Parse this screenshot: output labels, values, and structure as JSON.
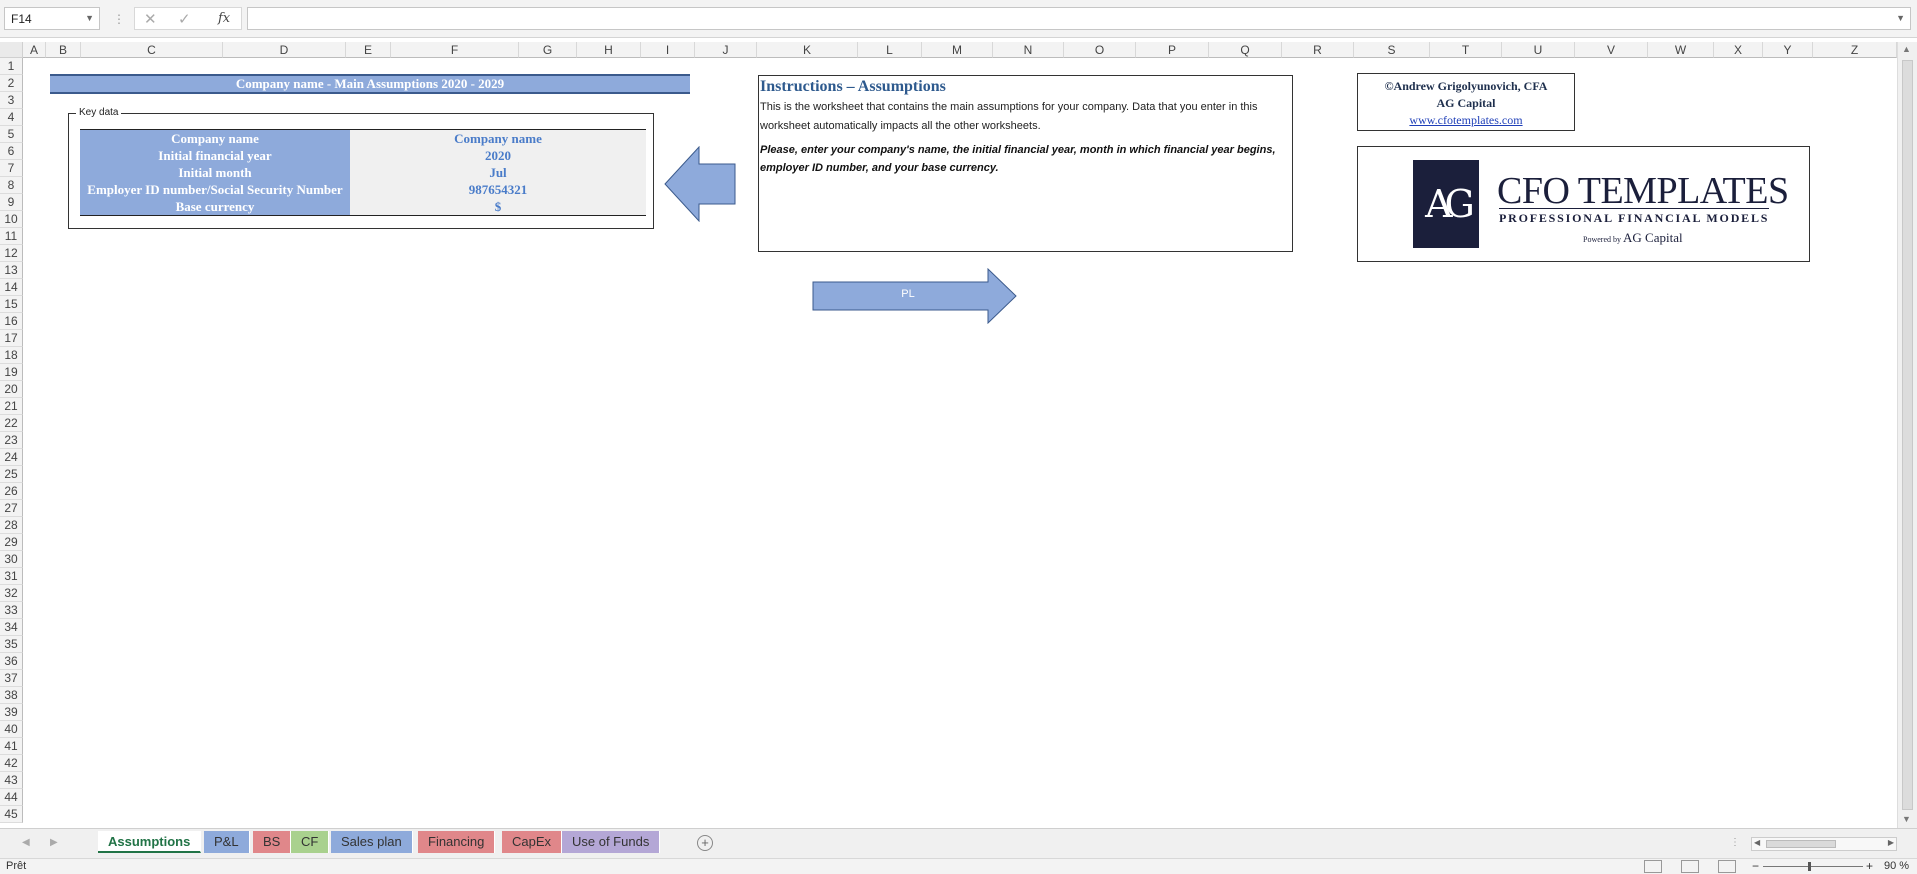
{
  "formula_bar": {
    "name_box": "F14",
    "cancel_glyph": "✕",
    "enter_glyph": "✓",
    "fx_label": "fx",
    "formula_value": ""
  },
  "columns": [
    "A",
    "B",
    "C",
    "D",
    "E",
    "F",
    "G",
    "H",
    "I",
    "J",
    "K",
    "L",
    "M",
    "N",
    "O",
    "P",
    "Q",
    "R",
    "S",
    "T",
    "U",
    "V",
    "W",
    "X",
    "Y",
    "Z"
  ],
  "rows": [
    "1",
    "2",
    "3",
    "4",
    "5",
    "6",
    "7",
    "8",
    "9",
    "10",
    "11",
    "12",
    "13",
    "14",
    "15",
    "16",
    "17",
    "18",
    "19",
    "20",
    "21",
    "22",
    "23",
    "24",
    "25",
    "26",
    "27",
    "28",
    "29",
    "30",
    "31",
    "32",
    "33",
    "34",
    "35",
    "36",
    "37",
    "38",
    "39",
    "40",
    "41",
    "42",
    "43",
    "44",
    "45"
  ],
  "sheet": {
    "title": "Company name - Main Assumptions 2020 - 2029",
    "key_data_group_label": "Key data",
    "key_data": [
      {
        "label": "Company name",
        "value": "Company name"
      },
      {
        "label": "Initial financial year",
        "value": "2020"
      },
      {
        "label": "Initial month",
        "value": "Jul"
      },
      {
        "label": "Employer ID number/Social Security Number",
        "value": "987654321"
      },
      {
        "label": "Base currency",
        "value": "$"
      }
    ],
    "instructions": {
      "title": "Instructions – Assumptions",
      "body": "This is the worksheet that contains the main assumptions for your company. Data that you enter in this worksheet automatically impacts all the other worksheets.",
      "emphasis": "Please, enter your company's name, the initial financial year, month in which financial year begins, employer ID number, and your base currency."
    },
    "nav_button_label": "PL",
    "credits": {
      "author": "©Andrew Grigolyunovich, CFA",
      "company": "AG Capital",
      "link": "www.cfotemplates.com"
    },
    "logo": {
      "mark": "AG",
      "title": "CFO TEMPLATES",
      "subtitle": "PROFESSIONAL FINANCIAL MODELS",
      "powered_by": "Powered by",
      "powered_brand": "AG Capital"
    }
  },
  "tabs": [
    {
      "label": "Assumptions",
      "color": "#ffffff",
      "active": true
    },
    {
      "label": "P&L",
      "color": "#8eaadb"
    },
    {
      "label": "BS",
      "color": "#e0878a"
    },
    {
      "label": "CF",
      "color": "#a9d18e"
    },
    {
      "label": "Sales plan",
      "color": "#8eaadb"
    },
    {
      "label": "Financing",
      "color": "#e0878a"
    },
    {
      "label": "CapEx",
      "color": "#e0878a"
    },
    {
      "label": "Use of Funds",
      "color": "#b4a7d6"
    }
  ],
  "status": {
    "ready": "Prêt",
    "zoom": "90 %"
  },
  "colors": {
    "accent_blue": "#8eaadb",
    "value_blue": "#4a7cc9",
    "excel_green": "#217346"
  }
}
